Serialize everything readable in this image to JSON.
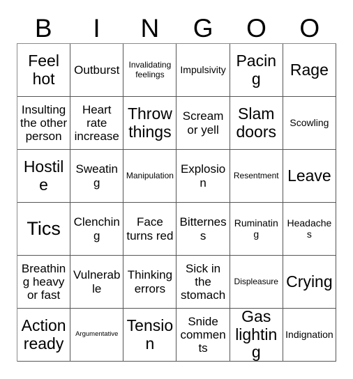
{
  "card": {
    "header_letters": [
      "B",
      "I",
      "N",
      "G",
      "O",
      "O"
    ],
    "columns": 6,
    "rows": 6,
    "border_color": "#555555",
    "background_color": "#ffffff",
    "text_color": "#000000",
    "cells": [
      [
        {
          "text": "Feel hot",
          "size": "lg"
        },
        {
          "text": "Outburst",
          "size": "md"
        },
        {
          "text": "Invalidating feelings",
          "size": "xs"
        },
        {
          "text": "Impulsivity",
          "size": "sm"
        },
        {
          "text": "Pacing",
          "size": "lg"
        },
        {
          "text": "Rage",
          "size": "lg"
        }
      ],
      [
        {
          "text": "Insulting the other person",
          "size": "md"
        },
        {
          "text": "Heart rate increase",
          "size": "md"
        },
        {
          "text": "Throw things",
          "size": "lg"
        },
        {
          "text": "Scream or yell",
          "size": "md"
        },
        {
          "text": "Slam doors",
          "size": "lg"
        },
        {
          "text": "Scowling",
          "size": "sm"
        }
      ],
      [
        {
          "text": "Hostile",
          "size": "lg"
        },
        {
          "text": "Sweating",
          "size": "md"
        },
        {
          "text": "Manipulation",
          "size": "xs"
        },
        {
          "text": "Explosion",
          "size": "md"
        },
        {
          "text": "Resentment",
          "size": "xs"
        },
        {
          "text": "Leave",
          "size": "lg"
        }
      ],
      [
        {
          "text": "Tics",
          "size": "xl"
        },
        {
          "text": "Clenching",
          "size": "md"
        },
        {
          "text": "Face turns red",
          "size": "md"
        },
        {
          "text": "Bitterness",
          "size": "md"
        },
        {
          "text": "Ruminating",
          "size": "sm"
        },
        {
          "text": "Headaches",
          "size": "sm"
        }
      ],
      [
        {
          "text": "Breathing heavy or fast",
          "size": "md"
        },
        {
          "text": "Vulnerable",
          "size": "md"
        },
        {
          "text": "Thinking errors",
          "size": "md"
        },
        {
          "text": "Sick in the stomach",
          "size": "md"
        },
        {
          "text": "Displeasure",
          "size": "xs"
        },
        {
          "text": "Crying",
          "size": "lg"
        }
      ],
      [
        {
          "text": "Action ready",
          "size": "lg"
        },
        {
          "text": "Argumentative",
          "size": "xxs"
        },
        {
          "text": "Tension",
          "size": "lg"
        },
        {
          "text": "Snide comments",
          "size": "md"
        },
        {
          "text": "Gas lighting",
          "size": "lg"
        },
        {
          "text": "Indignation",
          "size": "sm"
        }
      ]
    ]
  }
}
